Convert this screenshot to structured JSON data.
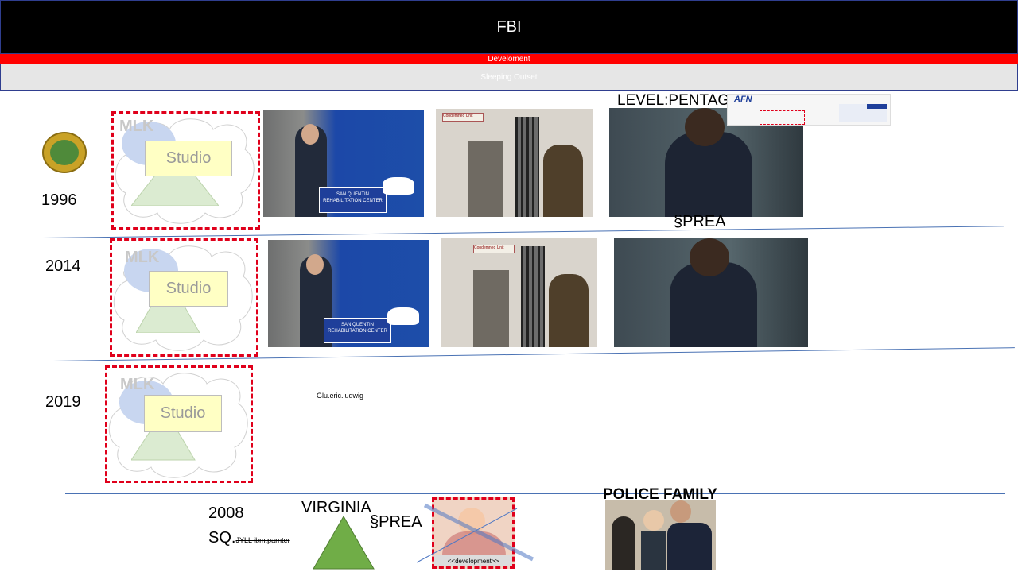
{
  "header": {
    "title": "FBI",
    "subtitle": "Develoment",
    "banner": "Sleeping Outset"
  },
  "rows": [
    {
      "year": "1996",
      "mlk": "MLK",
      "studio": "Studio"
    },
    {
      "year": "2014",
      "mlk": "MLK",
      "studio": "Studio"
    },
    {
      "year": "2019",
      "mlk": "MLK",
      "studio": "Studio"
    }
  ],
  "photos": {
    "podium_sign": "SAN QUENTIN REHABILITATION CENTER",
    "door_sign": "Condemned Unit"
  },
  "labels": {
    "level": "LEVEL:PENTAG",
    "afn": "AFN",
    "prea_top": "§PREA",
    "author": "Glu.eric.ludwig",
    "year_2008": "2008",
    "sq": "SQ.",
    "jyll": "JYLL ibm.parnter",
    "virginia": "VIRGINIA",
    "prea_bottom": "§PREA",
    "development": "<<development>>",
    "police_family": "POLICE FAMILY"
  },
  "colors": {
    "accent_red": "#e0001b",
    "bar_red": "#ff0000",
    "separator": "#4a72b4",
    "triangle_green": "#70ad47"
  }
}
